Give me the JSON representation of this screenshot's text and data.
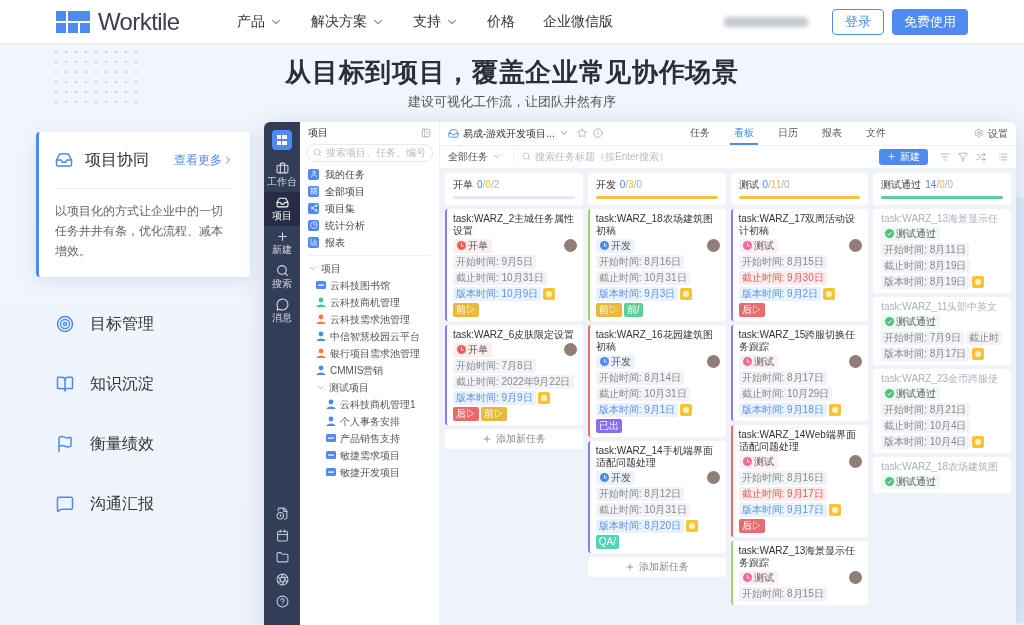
{
  "nav": {
    "logo": "Worktile",
    "menu": [
      {
        "label": "产品",
        "dropdown": true
      },
      {
        "label": "解决方案",
        "dropdown": true
      },
      {
        "label": "支持",
        "dropdown": true
      },
      {
        "label": "价格",
        "dropdown": false
      },
      {
        "label": "企业微信版",
        "dropdown": false
      }
    ],
    "login": "登录",
    "signup": "免费使用"
  },
  "hero": {
    "title": "从目标到项目，覆盖企业常见协作场景",
    "subtitle": "建设可视化工作流，让团队井然有序"
  },
  "features": [
    {
      "label": "项目协同",
      "selected": true,
      "link": "查看更多",
      "description": "以项目化的方式让企业中的一切任务井井有条，优化流程、减本增效。"
    },
    {
      "label": "目标管理",
      "selected": false
    },
    {
      "label": "知识沉淀",
      "selected": false
    },
    {
      "label": "衡量绩效",
      "selected": false
    },
    {
      "label": "沟通汇报",
      "selected": false
    }
  ],
  "app": {
    "rail": [
      {
        "label": "工作台",
        "selected": false
      },
      {
        "label": "项目",
        "selected": true
      },
      {
        "label": "新建",
        "selected": false
      },
      {
        "label": "搜索",
        "selected": false
      },
      {
        "label": "消息",
        "selected": false
      }
    ],
    "sidebar": {
      "title": "项目",
      "search_placeholder": "搜索项目、任务、编号",
      "items": [
        "我的任务",
        "全部项目",
        "项目集",
        "统计分析",
        "报表"
      ],
      "tree": {
        "label": "项目",
        "expanded": true,
        "children": [
          {
            "label": "云科技图书馆",
            "kind": "board",
            "color": "#4e8af0"
          },
          {
            "label": "云科技商机管理",
            "kind": "person",
            "color": "#3cc79a"
          },
          {
            "label": "云科技需求池管理",
            "kind": "person",
            "color": "#f27a4b"
          },
          {
            "label": "中信智慧校园云平台",
            "kind": "person",
            "color": "#4e8af0"
          },
          {
            "label": "银行项目需求池管理",
            "kind": "person",
            "color": "#f27a4b"
          },
          {
            "label": "CMMIS营销",
            "kind": "person",
            "color": "#4e8af0"
          },
          {
            "label": "测试项目",
            "kind": "group",
            "expanded": true,
            "children": [
              {
                "label": "云科技商机管理1",
                "kind": "person",
                "color": "#4e8af0"
              },
              {
                "label": "个人事务安排",
                "kind": "person",
                "color": "#4e8af0"
              },
              {
                "label": "产品销售支持",
                "kind": "board",
                "color": "#4e8af0"
              },
              {
                "label": "敏捷需求项目",
                "kind": "board",
                "color": "#4e8af0"
              },
              {
                "label": "敏捷开发项目",
                "kind": "board",
                "color": "#4e8af0"
              }
            ]
          }
        ]
      }
    }
  },
  "project": {
    "name": "易成-游戏开发项目...",
    "tabs": [
      {
        "label": "任务",
        "selected": false
      },
      {
        "label": "看板",
        "selected": true
      },
      {
        "label": "日历",
        "selected": false
      },
      {
        "label": "报表",
        "selected": false
      },
      {
        "label": "文件",
        "selected": false
      }
    ],
    "settings": "设置",
    "filter": "全部任务",
    "search_placeholder": "搜索任务标题（按Enter搜索）",
    "new_button": "新建"
  },
  "board": {
    "separator": "/",
    "columns": [
      {
        "name": "开单",
        "counts": [
          "0",
          "0",
          "2"
        ],
        "color": "#e3e8f3",
        "add_label": "添加新任务",
        "cards": [
          {
            "title": "task:WARZ_2主城任务属性设置",
            "color": "#8b7cf6",
            "done": false,
            "avatar": true,
            "status": {
              "text": "开单",
              "color": "#f0605a"
            },
            "dates": [
              {
                "text": "开始时间: 9月5日",
                "kind": "plain"
              },
              {
                "text": "截止时间: 10月31日",
                "kind": "plain"
              },
              {
                "text": "版本时间: 10月9日",
                "kind": "version"
              }
            ],
            "tags": [
              {
                "kind": "flag"
              },
              {
                "kind": "label",
                "text": "前▷",
                "color": "#e8b93a"
              }
            ]
          },
          {
            "title": "task:WARZ_6皮肤限定设置",
            "color": "#8b7cf6",
            "done": false,
            "avatar": true,
            "status": {
              "text": "开单",
              "color": "#f0605a"
            },
            "dates": [
              {
                "text": "开始时间: 7月8日",
                "kind": "plain"
              },
              {
                "text": "截止时间: 2022年9月22日",
                "kind": "plain"
              },
              {
                "text": "版本时间: 9月9日",
                "kind": "version"
              }
            ],
            "tags": [
              {
                "kind": "flag"
              },
              {
                "kind": "label",
                "text": "后▷",
                "color": "#e86b6b"
              },
              {
                "kind": "label",
                "text": "前▷",
                "color": "#e8b93a"
              }
            ]
          }
        ]
      },
      {
        "name": "开发",
        "counts": [
          "0",
          "3",
          "0"
        ],
        "color": "#f5c242",
        "add_label": "添加新任务",
        "cards": [
          {
            "title": "task:WARZ_18农场建筑图初稿",
            "color": "#9fd663",
            "done": false,
            "avatar": true,
            "status": {
              "text": "开发",
              "color": "#4e8af0"
            },
            "dates": [
              {
                "text": "开始时间: 8月16日",
                "kind": "plain"
              },
              {
                "text": "截止时间: 10月31日",
                "kind": "plain"
              },
              {
                "text": "版本时间: 9月3日",
                "kind": "version"
              }
            ],
            "tags": [
              {
                "kind": "flag"
              },
              {
                "kind": "label",
                "text": "前▷",
                "color": "#e8b93a"
              },
              {
                "kind": "label",
                "text": "前/",
                "color": "#5ccf93"
              }
            ]
          },
          {
            "title": "task:WARZ_16花园建筑图初稿",
            "color": "#f06a6a",
            "done": false,
            "avatar": true,
            "status": {
              "text": "开发",
              "color": "#4e8af0"
            },
            "dates": [
              {
                "text": "开始时间: 8月14日",
                "kind": "plain"
              },
              {
                "text": "截止时间: 10月31日",
                "kind": "plain"
              },
              {
                "text": "版本时间: 9月1日",
                "kind": "version"
              }
            ],
            "tags": [
              {
                "kind": "flag"
              },
              {
                "kind": "label",
                "text": "已出",
                "color": "#8a6cf0"
              }
            ]
          },
          {
            "title": "task:WARZ_14手机端界面适配问题处理",
            "color": "#8b7cf6",
            "done": false,
            "avatar": true,
            "status": {
              "text": "开发",
              "color": "#4e8af0"
            },
            "dates": [
              {
                "text": "开始时间: 8月12日",
                "kind": "plain"
              },
              {
                "text": "截止时间: 10月31日",
                "kind": "plain"
              },
              {
                "text": "版本时间: 8月20日",
                "kind": "version"
              }
            ],
            "tags": [
              {
                "kind": "flag"
              },
              {
                "kind": "label",
                "text": "QA/",
                "color": "#4fd6b6"
              }
            ]
          }
        ]
      },
      {
        "name": "测试",
        "counts": [
          "0",
          "11",
          "0"
        ],
        "color": "#f5c242",
        "cards": [
          {
            "title": "task:WARZ_17双周活动设计初稿",
            "color": "#8b7cf6",
            "done": false,
            "avatar": true,
            "status": {
              "text": "测试",
              "color": "#f06a9a"
            },
            "dates": [
              {
                "text": "开始时间: 8月15日",
                "kind": "plain"
              },
              {
                "text": "截止时间: 9月30日",
                "kind": "overdue"
              },
              {
                "text": "版本时间: 9月2日",
                "kind": "version"
              }
            ],
            "tags": [
              {
                "kind": "flag"
              },
              {
                "kind": "label",
                "text": "后▷",
                "color": "#e86b6b"
              }
            ]
          },
          {
            "title": "task:WARZ_15跨服切换任务跟踪",
            "color": "#8b7cf6",
            "done": false,
            "avatar": true,
            "status": {
              "text": "测试",
              "color": "#f06a9a"
            },
            "dates": [
              {
                "text": "开始时间: 8月17日",
                "kind": "plain"
              },
              {
                "text": "截止时间: 10月29日",
                "kind": "plain"
              },
              {
                "text": "版本时间: 9月18日",
                "kind": "version"
              }
            ],
            "tags": [
              {
                "kind": "flag"
              }
            ]
          },
          {
            "title": "task:WARZ_14Web端界面适配问题处理",
            "color": "#f06a6a",
            "done": false,
            "avatar": true,
            "status": {
              "text": "测试",
              "color": "#f06a9a"
            },
            "dates": [
              {
                "text": "开始时间: 8月16日",
                "kind": "plain"
              },
              {
                "text": "截止时间: 9月17日",
                "kind": "overdue"
              },
              {
                "text": "版本时间: 9月17日",
                "kind": "version"
              }
            ],
            "tags": [
              {
                "kind": "flag"
              },
              {
                "kind": "label",
                "text": "后▷",
                "color": "#e86b6b"
              }
            ]
          },
          {
            "title": "task:WARZ_13海景显示任务跟踪",
            "color": "#9fd663",
            "done": false,
            "avatar": true,
            "status": {
              "text": "测试",
              "color": "#f06a9a"
            },
            "dates": [
              {
                "text": "开始时间: 8月15日",
                "kind": "plain"
              }
            ]
          }
        ]
      },
      {
        "name": "测试通过",
        "counts": [
          "14",
          "0",
          "0"
        ],
        "color": "#5ccf93",
        "cards": [
          {
            "title": "task:WARZ_13海景显示任",
            "done": true,
            "avatar": false,
            "status": {
              "text": "测试通过",
              "color": "#4cc37a"
            },
            "dates": [
              {
                "text": "开始时间: 8月11日",
                "kind": "plain"
              },
              {
                "text": "截止时间: 8月19日",
                "kind": "plain"
              },
              {
                "text": "版本时间: 8月19日",
                "kind": "plain"
              }
            ],
            "tags": [
              {
                "kind": "flag"
              }
            ]
          },
          {
            "title": "task:WARZ_11头部中英文",
            "done": true,
            "avatar": false,
            "status": {
              "text": "测试通过",
              "color": "#4cc37a"
            },
            "dates": [
              {
                "text": "开始时间: 7月9日",
                "kind": "plain"
              },
              {
                "text": "截止时",
                "kind": "plain"
              },
              {
                "text": "版本时间: 8月17日",
                "kind": "plain"
              }
            ],
            "tags": [
              {
                "kind": "flag"
              }
            ]
          },
          {
            "title": "task:WARZ_23金币跨服使",
            "done": true,
            "avatar": false,
            "status": {
              "text": "测试通过",
              "color": "#4cc37a"
            },
            "dates": [
              {
                "text": "开始时间: 8月21日",
                "kind": "plain"
              },
              {
                "text": "截止时间: 10月4日",
                "kind": "plain"
              },
              {
                "text": "版本时间: 10月4日",
                "kind": "plain"
              }
            ],
            "tags": [
              {
                "kind": "flag"
              }
            ]
          },
          {
            "title": "task:WARZ_18农场建筑图",
            "done": true,
            "avatar": false,
            "status": {
              "text": "测试通过",
              "color": "#4cc37a"
            }
          }
        ]
      }
    ]
  }
}
